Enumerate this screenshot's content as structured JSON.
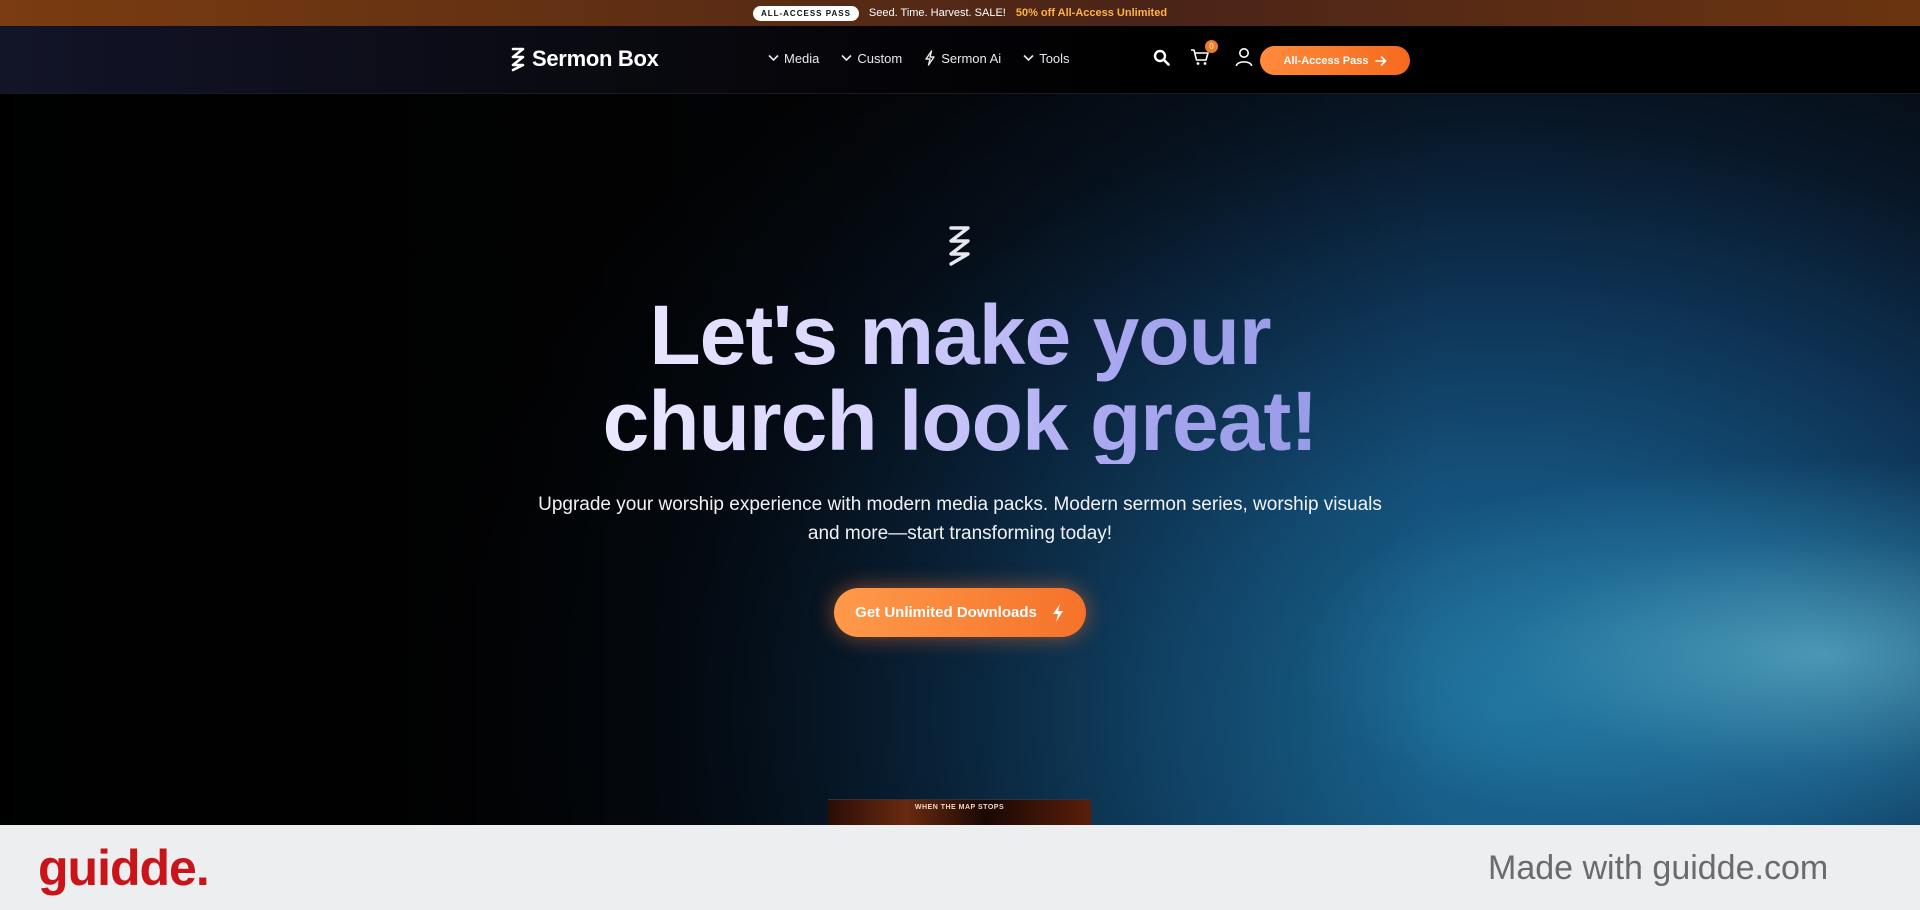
{
  "announcement": {
    "badge": "ALL-ACCESS PASS",
    "text": "Seed. Time. Harvest. SALE!",
    "offer": "50% off All-Access Unlimited"
  },
  "header": {
    "brand": "Sermon Box",
    "nav": [
      {
        "label": "Media",
        "icon": "chevron-down-icon"
      },
      {
        "label": "Custom",
        "icon": "chevron-down-icon"
      },
      {
        "label": "Sermon Ai",
        "icon": "bolt-icon"
      },
      {
        "label": "Tools",
        "icon": "chevron-down-icon"
      }
    ],
    "cart_count": "0",
    "cta_label": "All-Access Pass"
  },
  "hero": {
    "title_line1": "Let's make your",
    "title_line2": "church look great!",
    "subtitle": "Upgrade your worship experience with modern media packs. Modern sermon series, worship visuals and more—start transforming today!",
    "cta_label": "Get Unlimited Downloads",
    "preview_title": "WHEN THE MAP STOPS"
  },
  "watermark": {
    "logo": "guidde.",
    "tagline": "Made with guidde.com"
  },
  "colors": {
    "accent": "#f5722a",
    "announcement_link": "#ffb347",
    "guidde_red": "#c9141a"
  }
}
